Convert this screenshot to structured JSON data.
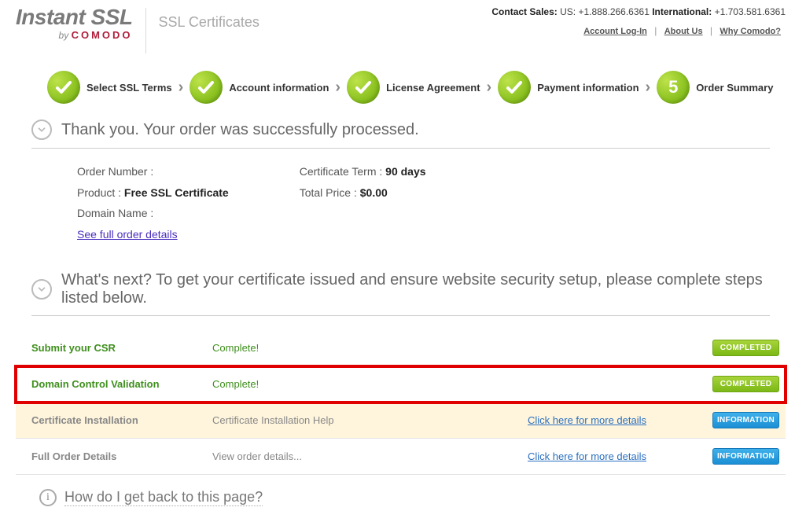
{
  "header": {
    "logo_main": "Instant SSL",
    "logo_by_prefix": "by",
    "logo_by_brand": "COMODO",
    "subtitle": "SSL Certificates",
    "contact_label": "Contact Sales:",
    "contact_us_label": "US:",
    "contact_us_phone": "+1.888.266.6361",
    "contact_intl_label": "International:",
    "contact_intl_phone": "+1.703.581.6361",
    "links": {
      "login": "Account Log-In",
      "about": "About Us",
      "why": "Why Comodo?"
    }
  },
  "steps": {
    "s1": "Select SSL Terms",
    "s2": "Account information",
    "s3": "License Agreement",
    "s4": "Payment information",
    "s5_num": "5",
    "s5": "Order Summary"
  },
  "thankyou": {
    "title": "Thank you. Your order was successfully processed.",
    "order_number_label": "Order Number :",
    "order_number_value": "",
    "product_label": "Product :",
    "product_value": "Free SSL Certificate",
    "domain_label": "Domain Name :",
    "domain_value": "",
    "see_full": "See full order details",
    "term_label": "Certificate Term :",
    "term_value": "90 days",
    "price_label": "Total Price :",
    "price_value": "$0.00"
  },
  "nextsteps": {
    "title": "What's next? To get your certificate issued and ensure website security setup, please complete steps listed below."
  },
  "rows": {
    "r1": {
      "name": "Submit your CSR",
      "status": "Complete!",
      "btn": "COMPLETED"
    },
    "r2": {
      "name": "Domain Control Validation",
      "status": "Complete!",
      "btn": "COMPLETED"
    },
    "r3": {
      "name": "Certificate Installation",
      "status": "Certificate Installation Help",
      "link": "Click here for more details",
      "btn": "INFORMATION"
    },
    "r4": {
      "name": "Full Order Details",
      "status": "View order details...",
      "link": "Click here for more details",
      "btn": "INFORMATION"
    }
  },
  "howdo": {
    "text": "How do I get back to this page?"
  }
}
